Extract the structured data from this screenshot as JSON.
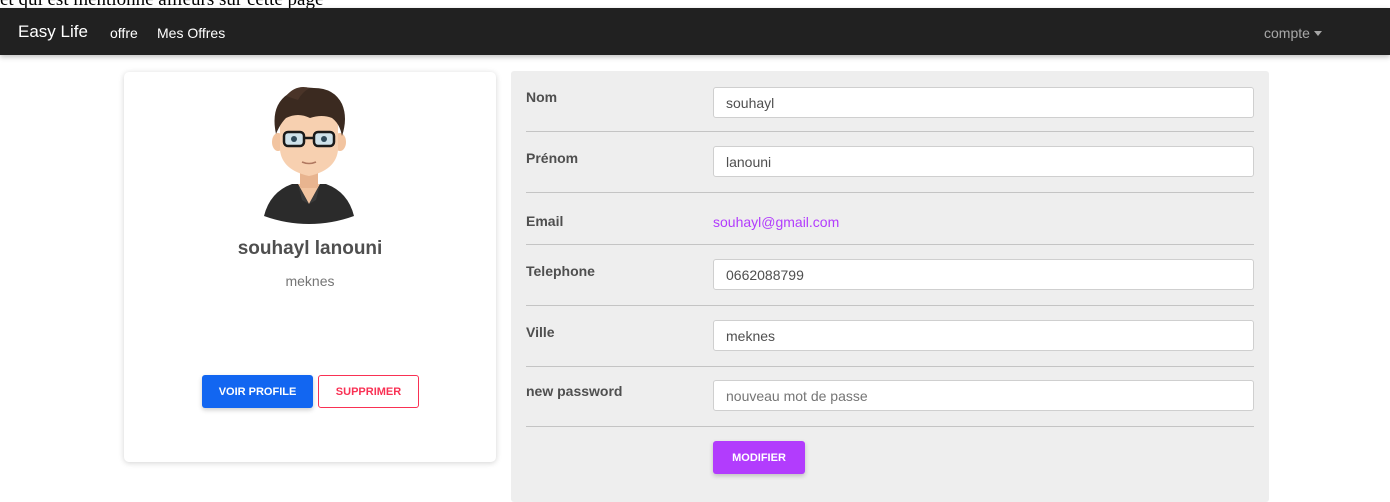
{
  "top_strip": "et qui est mentionné ailleurs sur cette page",
  "navbar": {
    "brand": "Easy Life",
    "links": [
      "offre",
      "Mes Offres"
    ],
    "account_label": "compte",
    "account_icon": "caret-down-icon"
  },
  "profile": {
    "avatar_icon": "avatar-icon",
    "name": "souhayl lanouni",
    "city": "meknes",
    "view_button": "VOIR PROFILE",
    "delete_button": "SUPPRIMER"
  },
  "form": {
    "nom": {
      "label": "Nom",
      "value": "souhayl"
    },
    "prenom": {
      "label": "Prénom",
      "value": "lanouni"
    },
    "email": {
      "label": "Email",
      "value": "souhayl@gmail.com"
    },
    "telephone": {
      "label": "Telephone",
      "value": "0662088799"
    },
    "ville": {
      "label": "Ville",
      "value": "meknes"
    },
    "password": {
      "label": "new password",
      "placeholder": "nouveau mot de passe"
    },
    "submit": "MODIFIER"
  },
  "colors": {
    "navbar": "#212121",
    "primary": "#1266f1",
    "danger": "#f93154",
    "secondary": "#b23cfd"
  }
}
